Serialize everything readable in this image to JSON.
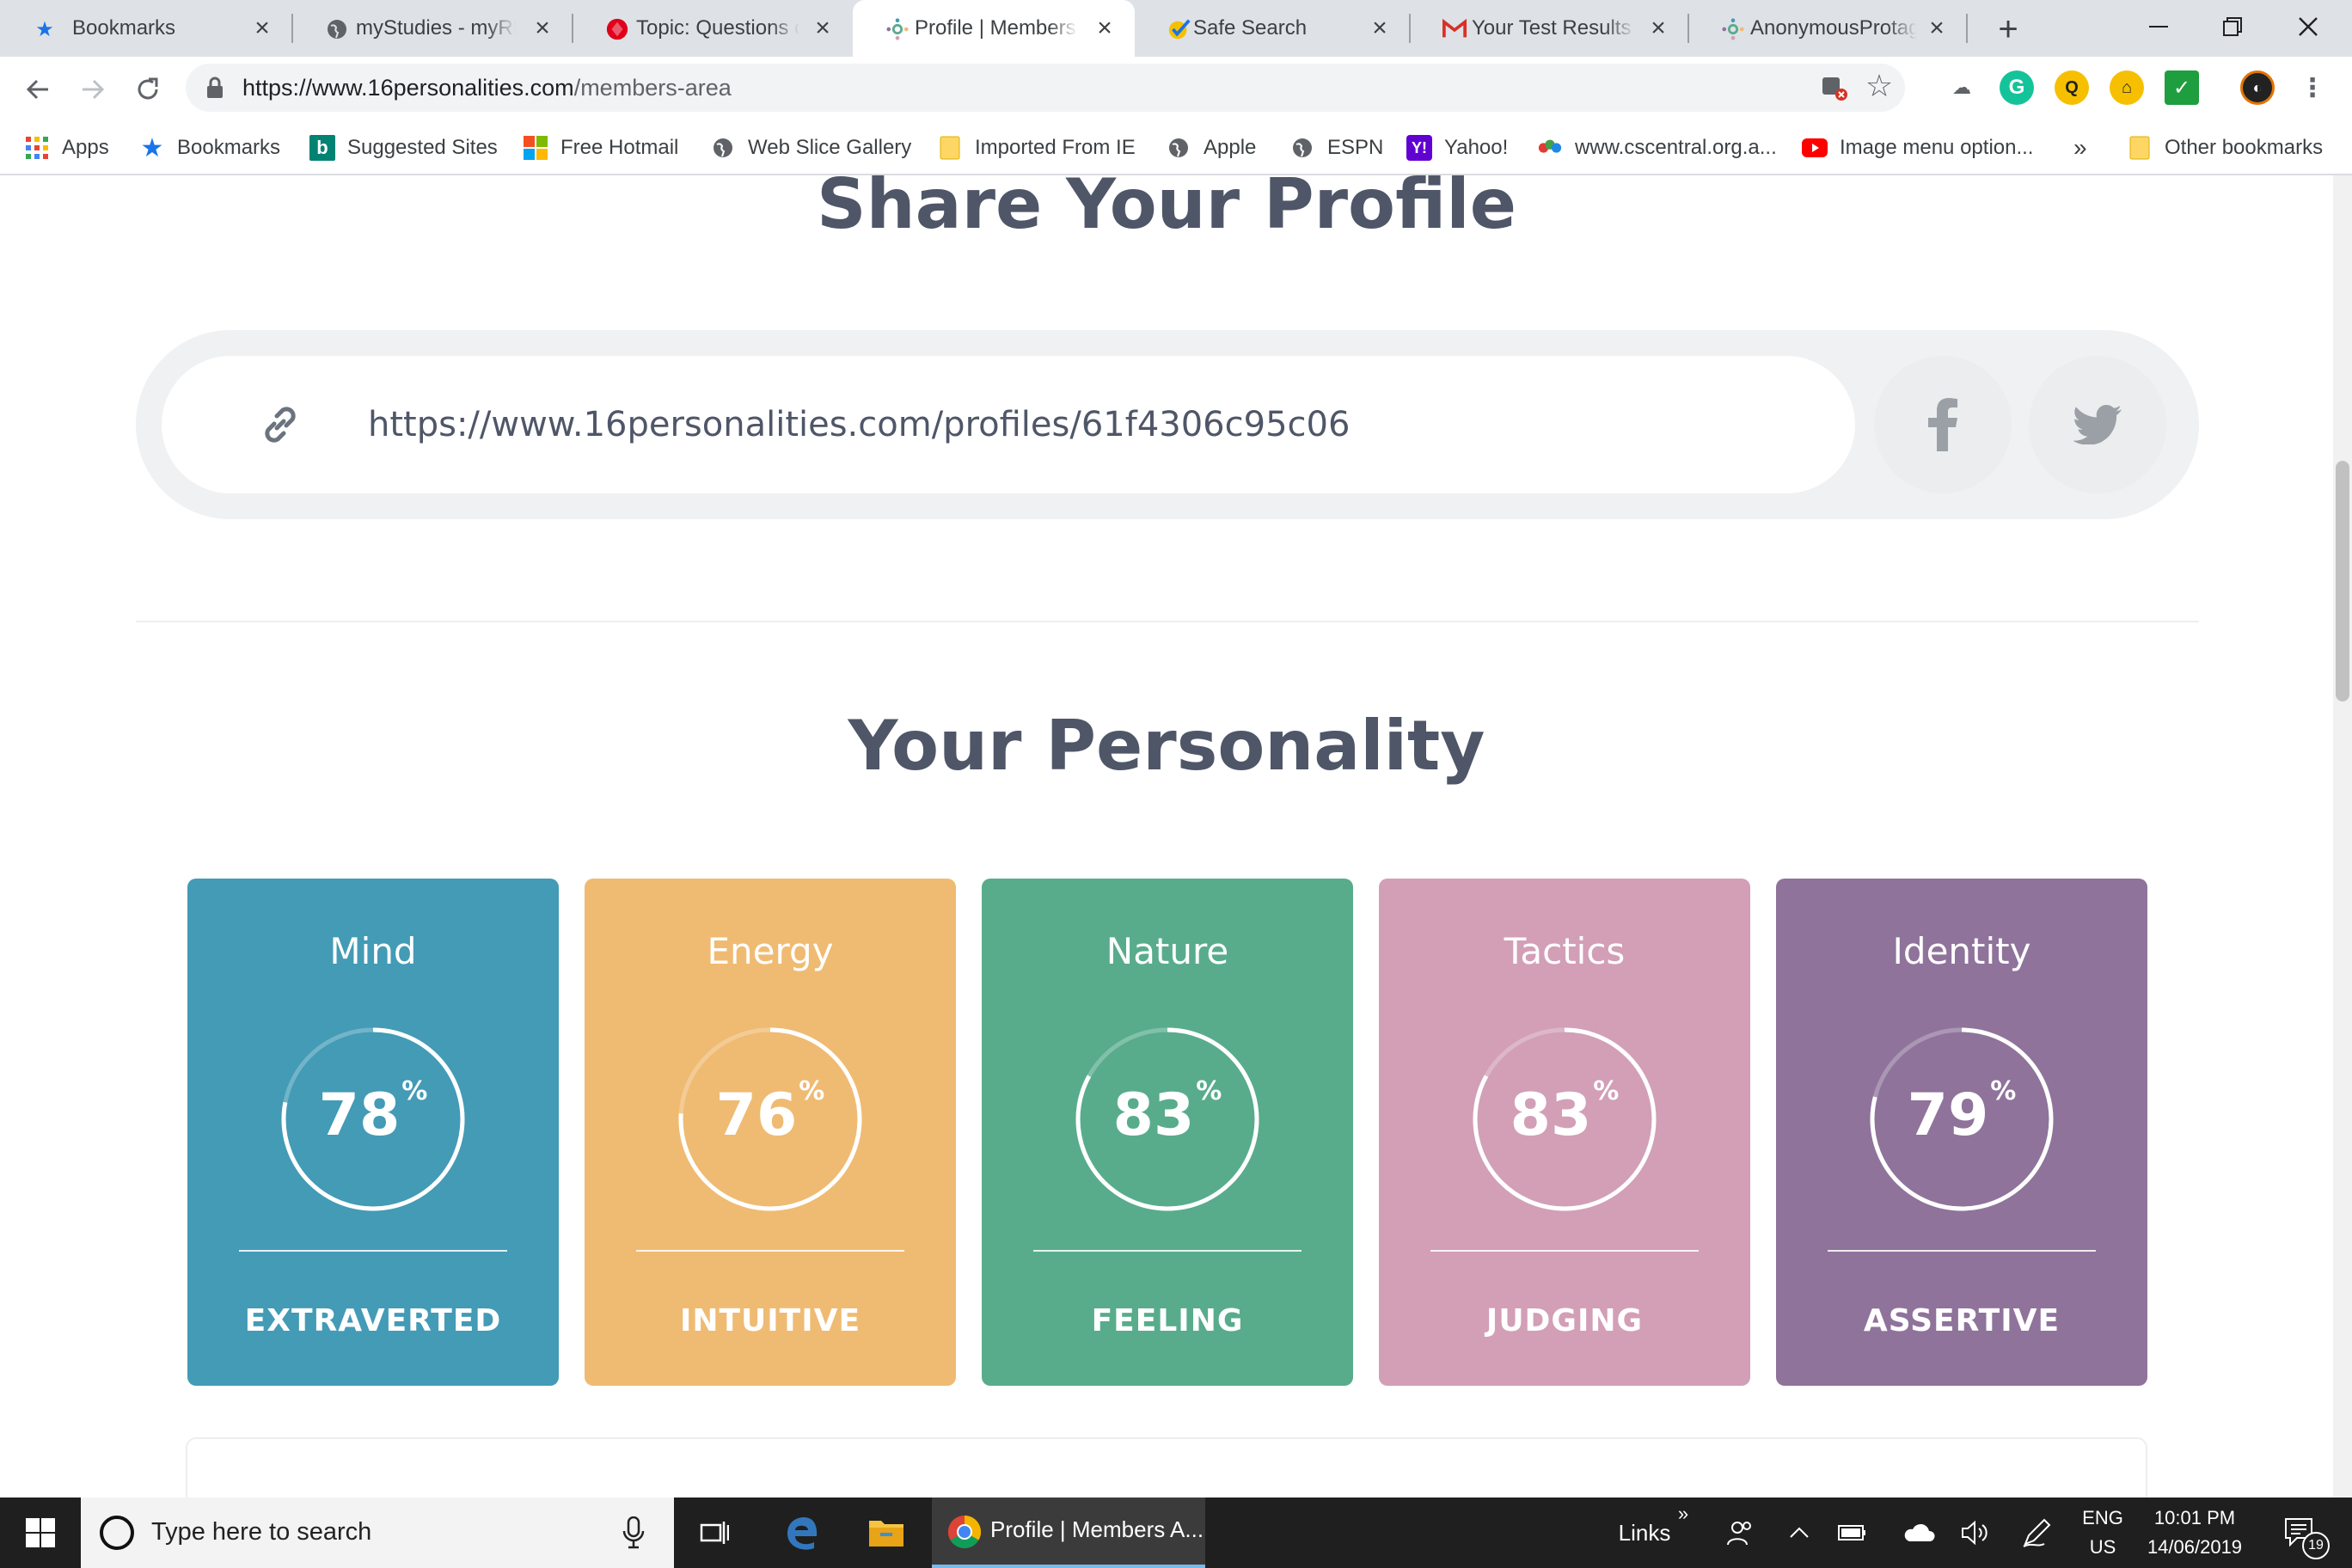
{
  "browser": {
    "tabs": [
      {
        "title": "Bookmarks",
        "icon": "star-icon",
        "active": false
      },
      {
        "title": "myStudies - myRMIT",
        "icon": "globe-icon",
        "active": false
      },
      {
        "title": "Topic: Questions on",
        "icon": "forum-icon",
        "active": false
      },
      {
        "title": "Profile | Members Area",
        "icon": "16personalities-icon",
        "active": true
      },
      {
        "title": "Safe Search",
        "icon": "check-badge-icon",
        "active": false
      },
      {
        "title": "Your Test Results - ",
        "icon": "gmail-icon",
        "active": false
      },
      {
        "title": "AnonymousProtagonist",
        "icon": "16personalities-icon",
        "active": false
      }
    ],
    "url": {
      "domain": "https://www.16personalities.com",
      "path": "/members-area"
    },
    "bookmarks": [
      {
        "label": "Apps",
        "icon": "apps-grid-icon"
      },
      {
        "label": "Bookmarks",
        "icon": "star-icon"
      },
      {
        "label": "Suggested Sites",
        "icon": "bing-icon"
      },
      {
        "label": "Free Hotmail",
        "icon": "windows-logo-icon"
      },
      {
        "label": "Web Slice Gallery",
        "icon": "globe-icon"
      },
      {
        "label": "Imported From IE",
        "icon": "folder-icon"
      },
      {
        "label": "Apple",
        "icon": "globe-icon"
      },
      {
        "label": "ESPN",
        "icon": "globe-icon"
      },
      {
        "label": "Yahoo!",
        "icon": "yahoo-icon"
      },
      {
        "label": "www.cscentral.org.a...",
        "icon": "cscentral-icon"
      },
      {
        "label": "Image menu option...",
        "icon": "youtube-icon"
      },
      {
        "label": "Other bookmarks",
        "icon": "folder-icon"
      }
    ],
    "bookmarks_overflow": "»"
  },
  "page": {
    "share_title": "Share Your Profile",
    "profile_url": "https://www.16personalities.com/profiles/61f4306c95c06",
    "personality_title": "Your Personality",
    "percent_sign": "%",
    "traits": [
      {
        "category": "Mind",
        "percent": 78,
        "trait": "EXTRAVERTED",
        "color": "#439bb6"
      },
      {
        "category": "Energy",
        "percent": 76,
        "trait": "INTUITIVE",
        "color": "#efbb72"
      },
      {
        "category": "Nature",
        "percent": 83,
        "trait": "FEELING",
        "color": "#58ac8c"
      },
      {
        "category": "Tactics",
        "percent": 83,
        "trait": "JUDGING",
        "color": "#d29fb7"
      },
      {
        "category": "Identity",
        "percent": 79,
        "trait": "ASSERTIVE",
        "color": "#8f739b"
      }
    ]
  },
  "taskbar": {
    "search_placeholder": "Type here to search",
    "chrome_task_label": "Profile | Members A...",
    "links_label": "Links",
    "lang_top": "ENG",
    "lang_bottom": "US",
    "time": "10:01 PM",
    "date": "14/06/2019",
    "notification_count": "19"
  }
}
